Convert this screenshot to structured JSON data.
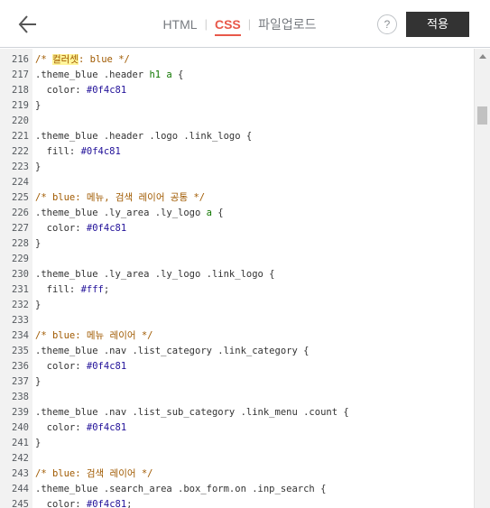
{
  "header": {
    "back_icon": "back-arrow-icon",
    "tabs": [
      {
        "label": "HTML",
        "active": false
      },
      {
        "label": "CSS",
        "active": true
      },
      {
        "label": "파일업로드",
        "active": false
      }
    ],
    "tab_separator": "|",
    "help_label": "?",
    "apply_label": "적용"
  },
  "colors": {
    "accent": "#e8584a",
    "apply_button": "#333333",
    "comment": "#a05a00",
    "value": "#221199",
    "tag": "#117700",
    "highlight": "#fff59a"
  },
  "editor": {
    "lines": [
      {
        "n": "216",
        "parts": [
          {
            "t": "/* ",
            "c": "comment"
          },
          {
            "t": "컬러셋",
            "c": "comment hl"
          },
          {
            "t": ": blue */",
            "c": "comment"
          }
        ]
      },
      {
        "n": "217",
        "parts": [
          {
            "t": ".theme_blue .header ",
            "c": "sel"
          },
          {
            "t": "h1 a",
            "c": "tag"
          },
          {
            "t": " {",
            "c": "sel"
          }
        ]
      },
      {
        "n": "218",
        "parts": [
          {
            "t": "  color: ",
            "c": "prop"
          },
          {
            "t": "#0f4c81",
            "c": "val"
          }
        ]
      },
      {
        "n": "219",
        "parts": [
          {
            "t": "}",
            "c": "sel"
          }
        ]
      },
      {
        "n": "220",
        "parts": []
      },
      {
        "n": "221",
        "parts": [
          {
            "t": ".theme_blue .header .logo .link_logo {",
            "c": "sel"
          }
        ]
      },
      {
        "n": "222",
        "parts": [
          {
            "t": "  fill: ",
            "c": "prop"
          },
          {
            "t": "#0f4c81",
            "c": "val"
          }
        ]
      },
      {
        "n": "223",
        "parts": [
          {
            "t": "}",
            "c": "sel"
          }
        ]
      },
      {
        "n": "224",
        "parts": []
      },
      {
        "n": "225",
        "parts": [
          {
            "t": "/* blue: 메뉴, 검색 레이어 공통 */",
            "c": "comment"
          }
        ]
      },
      {
        "n": "226",
        "parts": [
          {
            "t": ".theme_blue .ly_area .ly_logo ",
            "c": "sel"
          },
          {
            "t": "a",
            "c": "tag"
          },
          {
            "t": " {",
            "c": "sel"
          }
        ]
      },
      {
        "n": "227",
        "parts": [
          {
            "t": "  color: ",
            "c": "prop"
          },
          {
            "t": "#0f4c81",
            "c": "val"
          }
        ]
      },
      {
        "n": "228",
        "parts": [
          {
            "t": "}",
            "c": "sel"
          }
        ]
      },
      {
        "n": "229",
        "parts": []
      },
      {
        "n": "230",
        "parts": [
          {
            "t": ".theme_blue .ly_area .ly_logo .link_logo {",
            "c": "sel"
          }
        ]
      },
      {
        "n": "231",
        "parts": [
          {
            "t": "  fill: ",
            "c": "prop"
          },
          {
            "t": "#fff",
            "c": "val"
          },
          {
            "t": ";",
            "c": "sel"
          }
        ]
      },
      {
        "n": "232",
        "parts": [
          {
            "t": "}",
            "c": "sel"
          }
        ]
      },
      {
        "n": "233",
        "parts": []
      },
      {
        "n": "234",
        "parts": [
          {
            "t": "/* blue: 메뉴 레이어 */",
            "c": "comment"
          }
        ]
      },
      {
        "n": "235",
        "parts": [
          {
            "t": ".theme_blue .nav .list_category .link_category {",
            "c": "sel"
          }
        ]
      },
      {
        "n": "236",
        "parts": [
          {
            "t": "  color: ",
            "c": "prop"
          },
          {
            "t": "#0f4c81",
            "c": "val"
          }
        ]
      },
      {
        "n": "237",
        "parts": [
          {
            "t": "}",
            "c": "sel"
          }
        ]
      },
      {
        "n": "238",
        "parts": []
      },
      {
        "n": "239",
        "parts": [
          {
            "t": ".theme_blue .nav .list_sub_category .link_menu .count {",
            "c": "sel"
          }
        ]
      },
      {
        "n": "240",
        "parts": [
          {
            "t": "  color: ",
            "c": "prop"
          },
          {
            "t": "#0f4c81",
            "c": "val"
          }
        ]
      },
      {
        "n": "241",
        "parts": [
          {
            "t": "}",
            "c": "sel"
          }
        ]
      },
      {
        "n": "242",
        "parts": []
      },
      {
        "n": "243",
        "parts": [
          {
            "t": "/* blue: 검색 레이어 */",
            "c": "comment"
          }
        ]
      },
      {
        "n": "244",
        "parts": [
          {
            "t": ".theme_blue .search_area .box_form.on .inp_search {",
            "c": "sel"
          }
        ]
      },
      {
        "n": "245",
        "parts": [
          {
            "t": "  color: ",
            "c": "prop"
          },
          {
            "t": "#0f4c81",
            "c": "val"
          },
          {
            "t": ";",
            "c": "sel"
          }
        ]
      }
    ]
  },
  "scrollbar": {
    "up_icon": "scroll-up-arrow-icon"
  }
}
